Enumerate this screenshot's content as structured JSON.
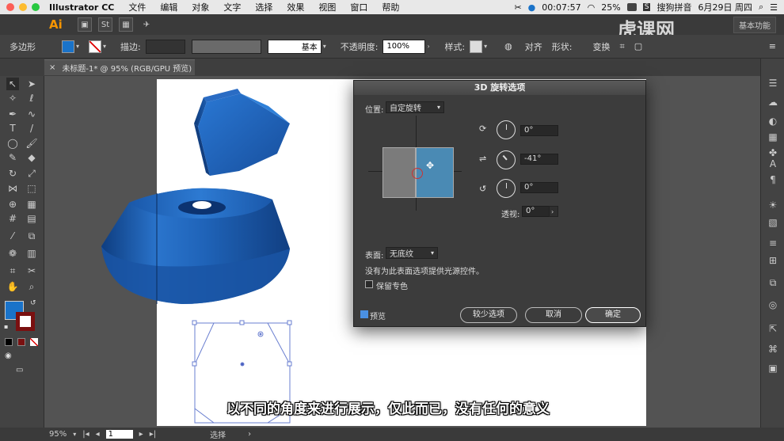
{
  "menubar": {
    "app_name": "Illustrator CC",
    "items": [
      "文件",
      "编辑",
      "对象",
      "文字",
      "选择",
      "效果",
      "视图",
      "窗口",
      "帮助"
    ],
    "clock": "00:07:57",
    "battery": "25%",
    "ime": "搜狗拼音",
    "date": "6月29日 周四"
  },
  "appbar": {
    "logo": "Ai",
    "workspace": "基本功能"
  },
  "control": {
    "shape_label": "多边形",
    "stroke_label": "描边:",
    "stroke_style": "基本",
    "opacity_label": "不透明度:",
    "opacity_value": "100%",
    "style_label": "样式:",
    "align_label": "对齐",
    "shape_menu": "形状:",
    "transform_label": "变换"
  },
  "document_tab": {
    "title": "未标题-1* @ 95% (RGB/GPU 预览)"
  },
  "status": {
    "zoom": "95%",
    "page": "1",
    "tool": "选择"
  },
  "dialog": {
    "title": "3D 旋转选项",
    "position_label": "位置:",
    "position_value": "自定旋转",
    "x_rotation": "0°",
    "y_rotation": "-41°",
    "z_rotation": "0°",
    "perspective_label": "透视:",
    "perspective_value": "0°",
    "surface_label": "表面:",
    "surface_value": "无底纹",
    "surface_note": "没有为此表面选项提供光源控件。",
    "preserve_spot_label": "保留专色",
    "preview_label": "预览",
    "fewer_options_label": "较少选项",
    "cancel_label": "取消",
    "ok_label": "确定"
  },
  "subtitle": "以不同的角度来进行展示，仅此而已，没有任何的意义",
  "watermark": "虎课网",
  "colors": {
    "fill": "#1a73c9",
    "shape_blue": "#1e5fb4",
    "dialog_bg": "#3c3c3c"
  }
}
